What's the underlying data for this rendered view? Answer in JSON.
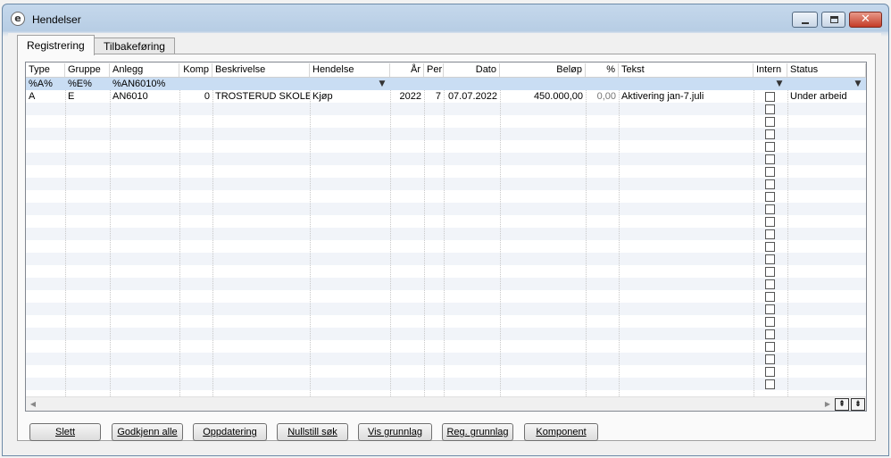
{
  "window": {
    "title": "Hendelser"
  },
  "tabs": [
    "Registrering",
    "Tilbakeføring"
  ],
  "table": {
    "columns": [
      "Type",
      "Gruppe",
      "Anlegg",
      "Komp",
      "Beskrivelse",
      "Hendelse",
      "År",
      "Per",
      "Dato",
      "Beløp",
      "%",
      "Tekst",
      "Intern",
      "Status"
    ],
    "filter": {
      "type": "%A%",
      "gruppe": "%E%",
      "anlegg": "%AN6010%"
    },
    "rows": [
      {
        "type": "A",
        "gruppe": "E",
        "anlegg": "AN6010",
        "komp": "0",
        "beskrivelse": "TROSTERUD SKOLE",
        "hendelse": "Kjøp",
        "aar": "2022",
        "per": "7",
        "dato": "07.07.2022",
        "belop": "450.000,00",
        "prosent": "0,00",
        "tekst": "Aktivering jan-7.juli",
        "intern": false,
        "status": "Under arbeid"
      }
    ]
  },
  "buttons": [
    "Slett",
    "Godkjenn alle",
    "Oppdatering",
    "Nullstill søk",
    "Vis grunnlag",
    "Reg. grunnlag",
    "Komponent"
  ]
}
